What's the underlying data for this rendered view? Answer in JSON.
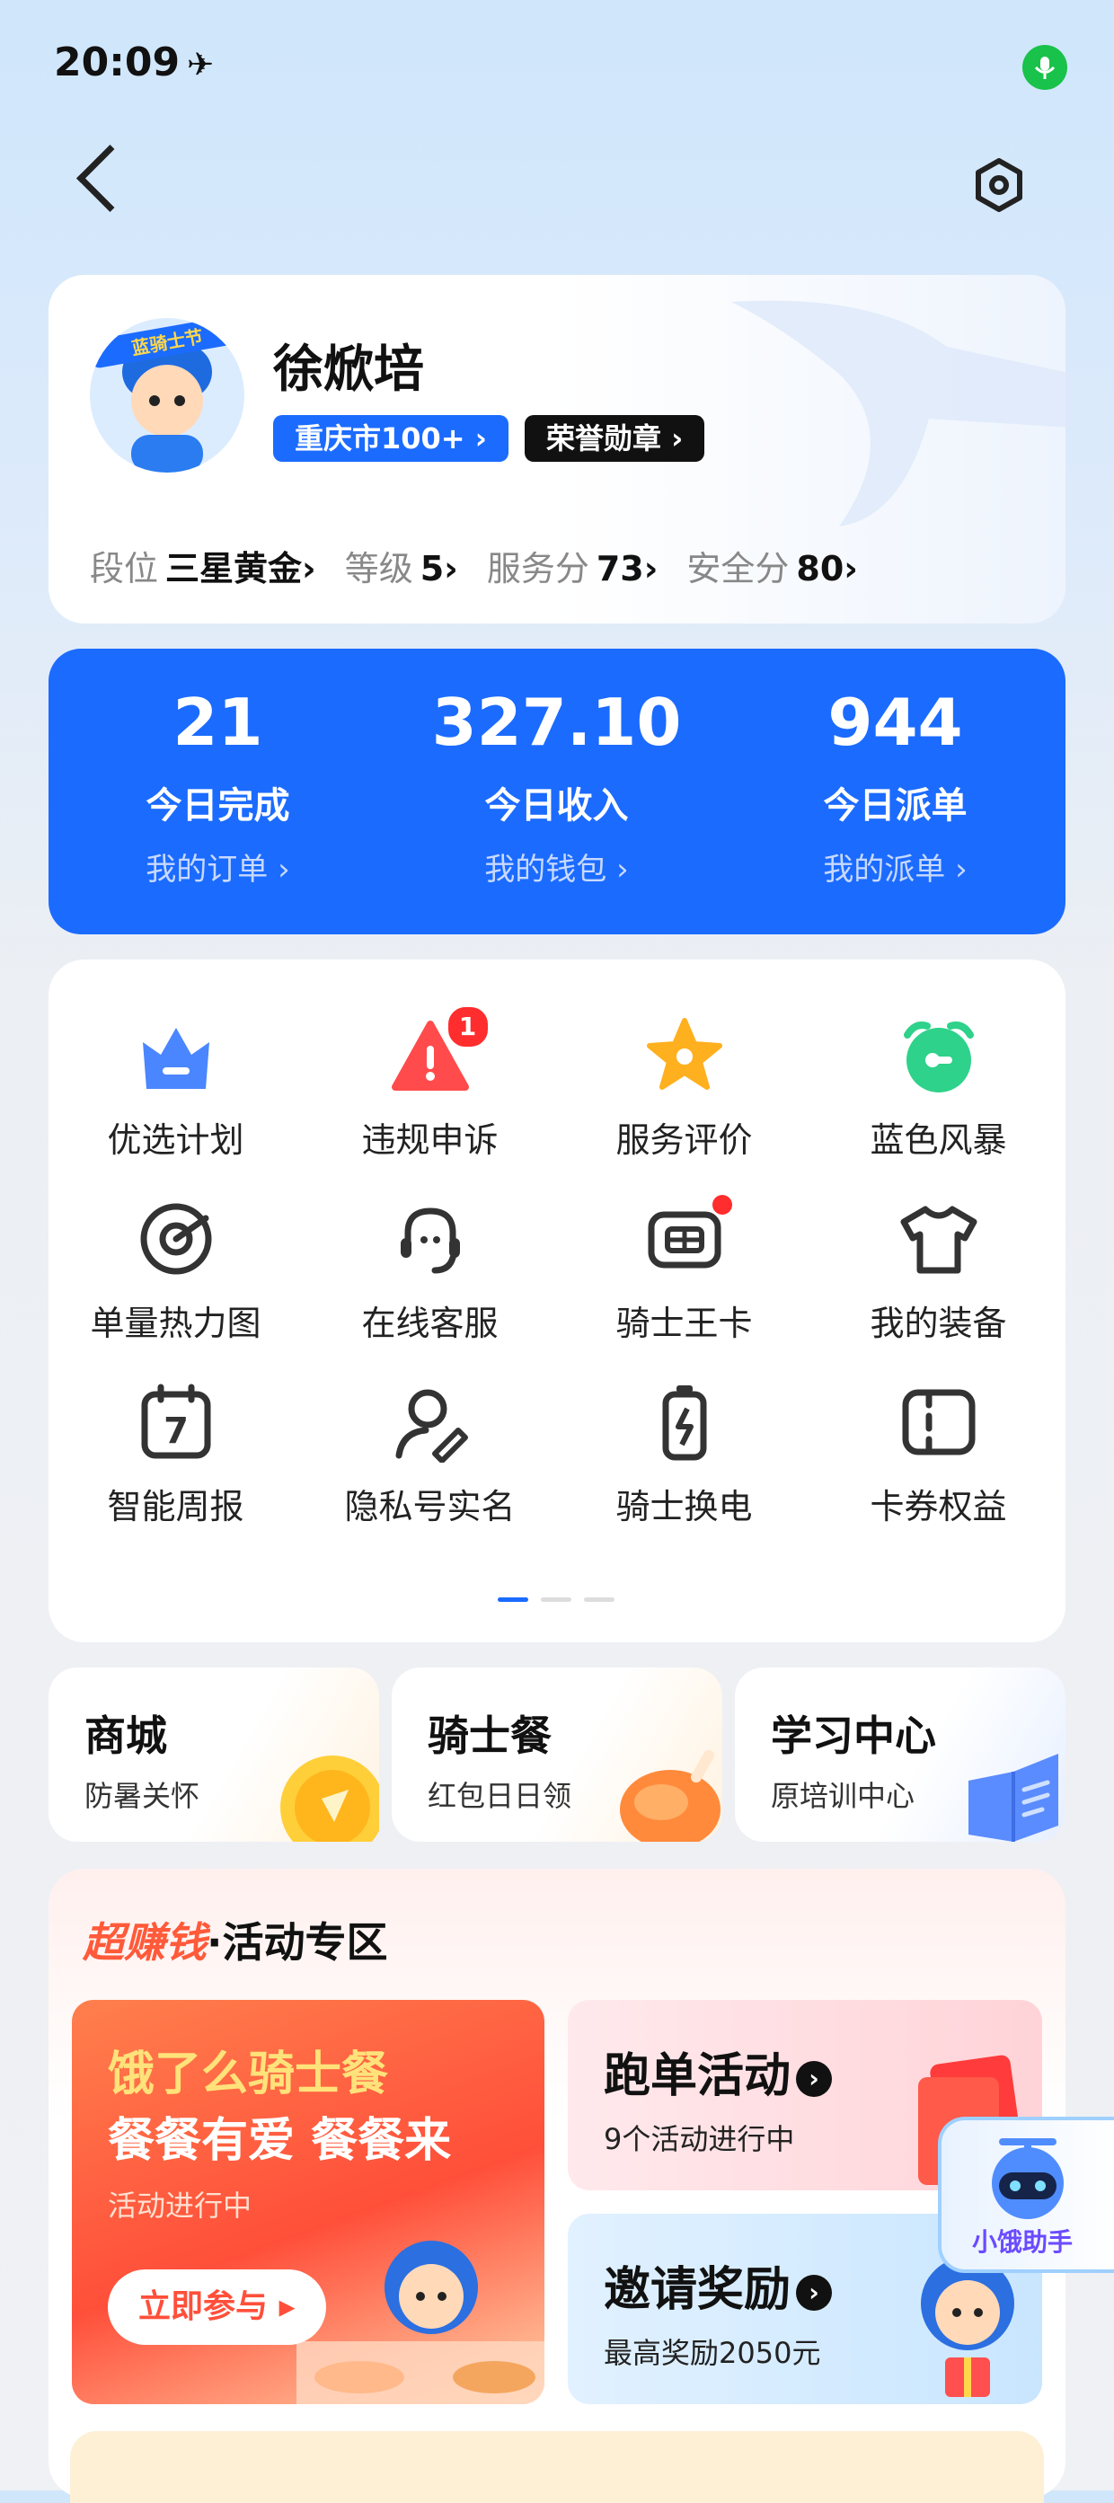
{
  "status_bar": {
    "time": "20:09"
  },
  "header": {
    "back_icon": "chevron-left-icon",
    "settings_icon": "settings-icon"
  },
  "profile": {
    "name": "徐焮培",
    "city_tag": "重庆市100+ ›",
    "honor_tag": "荣誉勋章 ›",
    "stats": [
      {
        "label": "段位",
        "value": "三星黄金›"
      },
      {
        "label": "等级",
        "value": "5›"
      },
      {
        "label": "服务分",
        "value": "73›"
      },
      {
        "label": "安全分",
        "value": "80›"
      }
    ]
  },
  "summary": [
    {
      "value": "21",
      "label": "今日完成",
      "link": "我的订单 ›"
    },
    {
      "value": "327.10",
      "label": "今日收入",
      "link": "我的钱包 ›"
    },
    {
      "value": "944",
      "label": "今日派单",
      "link": "我的派单 ›"
    }
  ],
  "grid": [
    {
      "label": "优选计划",
      "icon": "crown-icon"
    },
    {
      "label": "违规申诉",
      "icon": "warning-icon",
      "badge": "1"
    },
    {
      "label": "服务评价",
      "icon": "star-icon"
    },
    {
      "label": "蓝色风暴",
      "icon": "alarm-icon"
    },
    {
      "label": "单量热力图",
      "icon": "target-icon"
    },
    {
      "label": "在线客服",
      "icon": "headset-icon"
    },
    {
      "label": "骑士王卡",
      "icon": "card-icon",
      "dot": true
    },
    {
      "label": "我的装备",
      "icon": "tshirt-icon"
    },
    {
      "label": "智能周报",
      "icon": "calendar-icon"
    },
    {
      "label": "隐私号实名",
      "icon": "user-edit-icon"
    },
    {
      "label": "骑士换电",
      "icon": "battery-icon"
    },
    {
      "label": "卡券权益",
      "icon": "coupon-icon"
    }
  ],
  "shortcuts": [
    {
      "title": "商城",
      "sub": "防暑关怀"
    },
    {
      "title": "骑士餐",
      "sub": "红包日日领"
    },
    {
      "title": "学习中心",
      "sub": "原培训中心"
    }
  ],
  "activity": {
    "brand": "超赚钱",
    "title": "·活动专区",
    "banner": {
      "line1": "饿了么骑士餐",
      "line2": "餐餐有爱 餐餐来",
      "status": "活动进行中",
      "button": "立即参与"
    },
    "run": {
      "title": "跑单活动",
      "sub": "9个活动进行中"
    },
    "invite": {
      "title": "邀请奖励",
      "sub": "最高奖励2050元"
    }
  },
  "assistant": {
    "label": "小饿助手"
  },
  "colors": {
    "primary": "#1b6bff",
    "badge": "#ff2d2d"
  }
}
